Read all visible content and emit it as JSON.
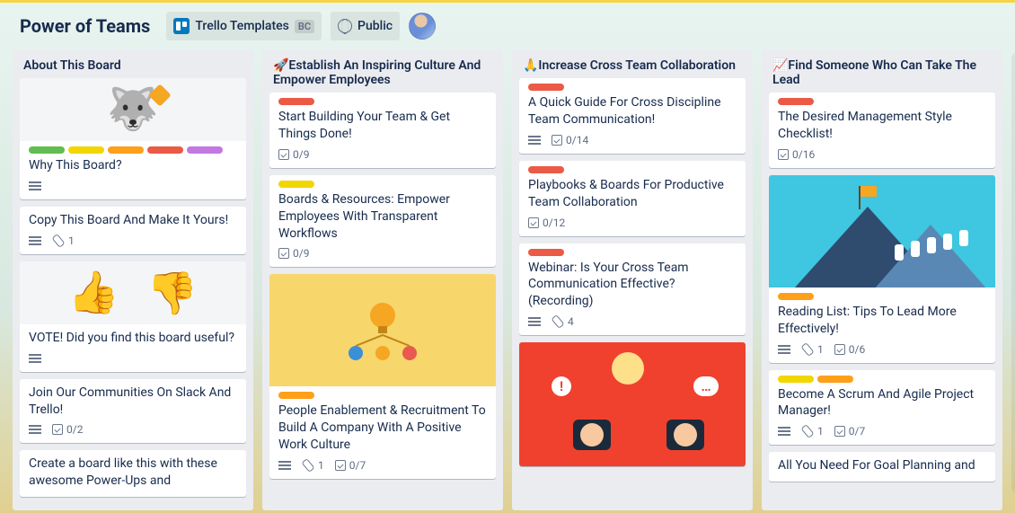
{
  "header": {
    "board_title": "Power of Teams",
    "template_chip": "Trello Templates",
    "template_badge": "BC",
    "visibility": "Public"
  },
  "label_colors": {
    "green": "#61bd4f",
    "yellow": "#f2d600",
    "orange": "#ff9f1a",
    "red": "#eb5a46",
    "purple": "#c377e0"
  },
  "lists": [
    {
      "title": "About This Board",
      "cards": [
        {
          "cover": "husky",
          "labels": [
            "green",
            "yellow",
            "orange",
            "red",
            "purple"
          ],
          "title": "Why This Board?",
          "description": true
        },
        {
          "title": "Copy This Board And Make It Yours!",
          "description": true,
          "attachments": "1"
        },
        {
          "cover": "thumbs",
          "title": "VOTE! Did you find this board useful?",
          "description": true
        },
        {
          "title": "Join Our Communities On Slack And Trello!",
          "description": true,
          "checklist": "0/2"
        },
        {
          "title": "Create a board like this with these awesome Power-Ups and"
        }
      ]
    },
    {
      "title": "🚀Establish An Inspiring Culture And Empower Employees",
      "cards": [
        {
          "labels": [
            "red"
          ],
          "title": "Start Building Your Team & Get Things Done!",
          "checklist": "0/9"
        },
        {
          "labels": [
            "yellow"
          ],
          "title": "Boards & Resources: Empower Employees With Transparent Workflows",
          "checklist": "0/9"
        },
        {
          "cover": "bulb",
          "labels": [
            "orange"
          ],
          "title": "People Enablement & Recruitment To Build A Company With A Positive Work Culture",
          "description": true,
          "attachments": "1",
          "checklist": "0/7"
        }
      ]
    },
    {
      "title": "🙏Increase Cross Team Collaboration",
      "cards": [
        {
          "labels": [
            "red"
          ],
          "title": "A Quick Guide For Cross Discipline Team Communication!",
          "description": true,
          "checklist": "0/14"
        },
        {
          "labels": [
            "red"
          ],
          "title": "Playbooks & Boards For Productive Team Collaboration",
          "checklist": "0/12"
        },
        {
          "labels": [
            "red"
          ],
          "title": "Webinar: Is Your Cross Team Communication Effective? (Recording)",
          "description": true,
          "attachments": "4"
        },
        {
          "cover": "chat"
        }
      ]
    },
    {
      "title": "📈Find Someone Who Can Take The Lead",
      "cards": [
        {
          "labels": [
            "red"
          ],
          "title": "The Desired Management Style Checklist!",
          "checklist": "0/16"
        },
        {
          "cover": "mountain",
          "labels": [
            "orange"
          ],
          "title": "Reading List: Tips To Lead More Effectively!",
          "description": true,
          "attachments": "1",
          "checklist": "0/6"
        },
        {
          "labels": [
            "yellow",
            "orange"
          ],
          "title": "Become A Scrum And Agile Project Manager!",
          "description": true,
          "attachments": "1",
          "checklist": "0/7"
        },
        {
          "title": "All You Need For Goal Planning and"
        }
      ]
    }
  ]
}
